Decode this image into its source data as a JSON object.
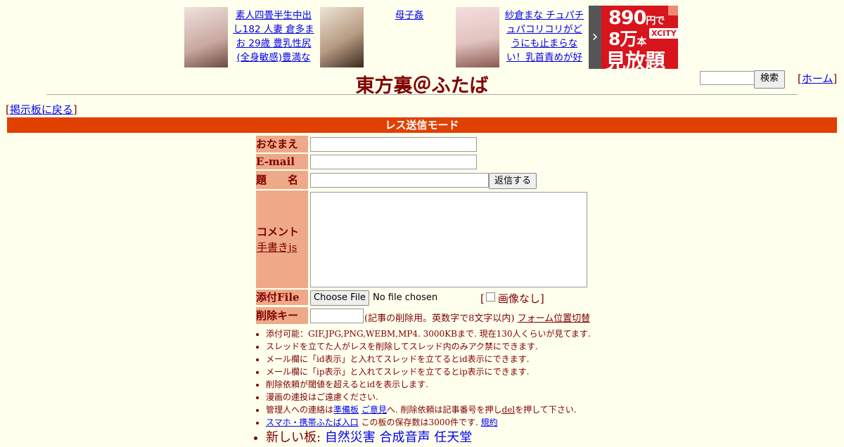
{
  "ads": [
    {
      "thumb_color": "#c9a8a0",
      "text": "素人四畳半生中出し182 人妻 倉多まお 29歳 豊乳性尻(全身敏感)豊満な"
    },
    {
      "thumb_color": "#b79b82",
      "text": "母子姦"
    },
    {
      "thumb_color": "#e2c3c0",
      "text": "紗倉まな チュパチュパコリコリがどうにも止まらない！乳首責めが好"
    }
  ],
  "banner": {
    "arrow": "›",
    "line1_num": "890",
    "line1_unit": "円で",
    "line2_num": "8万",
    "line2_unit": "本",
    "logo": "XCITY",
    "line3": "見放題"
  },
  "title": "東方裏＠ふたば",
  "search": {
    "button": "検索"
  },
  "home": {
    "label": "ホーム"
  },
  "back": {
    "label": "掲示板に戻る"
  },
  "mode_bar": "レス送信モード",
  "form": {
    "name_label": "おなまえ",
    "email_label": "E-mail",
    "subject_label": "題　　名",
    "submit": "返信する",
    "comment_label": "コメント",
    "handwrite": "手書きjs",
    "file_label": "添付File",
    "file_button": "Choose File",
    "file_status": "No file chosen",
    "noimage": "画像なし",
    "delkey_label": "削除キー",
    "delkey_note": "(記事の削除用。英数字で8文字以内)",
    "form_toggle": "フォーム位置切替"
  },
  "notes": {
    "n1": "添付可能：GIF,JPG,PNG,WEBM,MP4. 3000KBまで. 現在130人くらいが見てます.",
    "n2": "スレッドを立てた人がレスを削除してスレッド内のみアク禁にできます.",
    "n3": "メール欄に「id表示」と入れてスレッドを立てるとid表示にできます.",
    "n4": "メール欄に「ip表示」と入れてスレッドを立てるとip表示にできます.",
    "n5": "削除依頼が閾値を超えるとidを表示します.",
    "n6": "漫画の連投はご遠慮ください.",
    "n7a": "管理人への連絡は",
    "n7_link1": "準備板",
    "n7_link2": "ご意見",
    "n7b": "へ. 削除依頼は記事番号を押し",
    "n7_del": "del",
    "n7c": "を押して下さい.",
    "n8_link": "スマホ・携帯ふたば入口",
    "n8b": " この板の保存数は3000件です.",
    "n8_rules": "規約",
    "n9a": "新しい板:",
    "n9_boards": [
      "自然災害",
      "合成音声",
      "任天堂"
    ]
  }
}
